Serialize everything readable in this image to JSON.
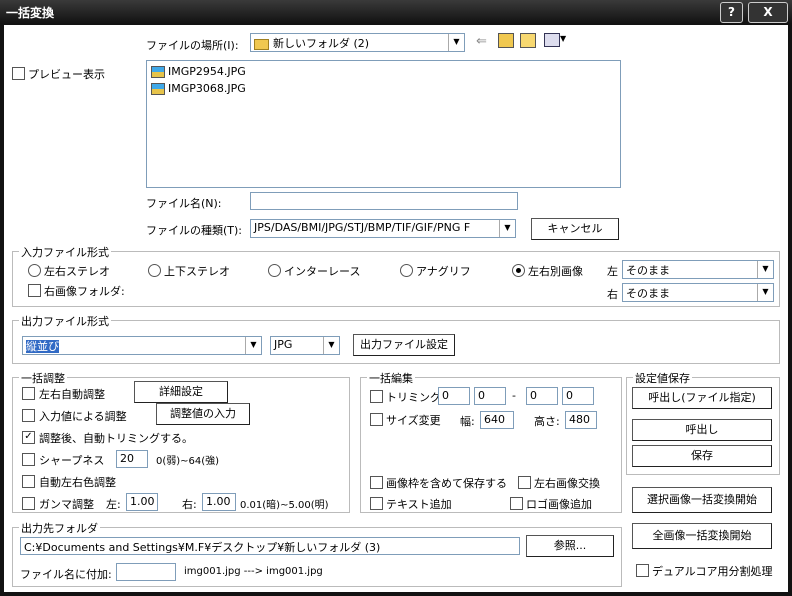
{
  "window": {
    "title": "一括変換",
    "help": "?",
    "close": "X"
  },
  "file_dialog": {
    "location_label": "ファイルの場所(I):",
    "location_value": "新しいフォルダ (2)",
    "preview_label": "プレビュー表示",
    "files": [
      "IMGP2954.JPG",
      "IMGP3068.JPG"
    ],
    "filename_label": "ファイル名(N):",
    "filename_value": "",
    "filetype_label": "ファイルの種類(T):",
    "filetype_value": "JPS/DAS/BMI/JPG/STJ/BMP/TIF/GIF/PNG F",
    "cancel_label": "キャンセル"
  },
  "input_format": {
    "title": "入力ファイル形式",
    "options": [
      "左右ステレオ",
      "上下ステレオ",
      "インターレース",
      "アナグリフ",
      "左右別画像"
    ],
    "selected": "左右別画像",
    "right_folder_label": "右画像フォルダ:",
    "left_label": "左",
    "left_value": "そのまま",
    "right_label": "右",
    "right_value": "そのまま"
  },
  "output_format": {
    "title": "出力ファイル形式",
    "layout_value": "縦並び",
    "format_value": "JPG",
    "settings_button": "出力ファイル設定"
  },
  "batch_adjust": {
    "title": "一括調整",
    "auto_adjust_label": "左右自動調整",
    "detail_button": "詳細設定",
    "input_adjust_label": "入力値による調整",
    "input_value_button": "調整値の入力",
    "auto_trim_label": "調整後、自動トリミングする。",
    "auto_trim_checked": true,
    "sharpness_label": "シャープネス",
    "sharpness_value": "20",
    "sharpness_range": "0(弱)~64(強)",
    "auto_color_label": "自動左右色調整",
    "gamma_label": "ガンマ調整",
    "gamma_left_label": "左:",
    "gamma_left_value": "1.00",
    "gamma_right_label": "右:",
    "gamma_right_value": "1.00",
    "gamma_range": "0.01(暗)~5.00(明)"
  },
  "batch_edit": {
    "title": "一括編集",
    "trim_label": "トリミング",
    "trim_values": [
      "0",
      "0",
      "0",
      "0"
    ],
    "trim_dash": "-",
    "resize_label": "サイズ変更",
    "width_label": "幅:",
    "width_value": "640",
    "height_label": "高さ:",
    "height_value": "480",
    "keep_frame_label": "画像枠を含めて保存する",
    "swap_lr_label": "左右画像交換",
    "add_text_label": "テキスト追加",
    "add_logo_label": "ロゴ画像追加"
  },
  "settings_save": {
    "title": "設定値保存",
    "load_file_button": "呼出し(ファイル指定)",
    "load_button": "呼出し",
    "save_button": "保存"
  },
  "output_folder": {
    "title": "出力先フォルダ",
    "path_value": "C:¥Documents and Settings¥M.F¥デスクトップ¥新しいフォルダ (3)",
    "browse_button": "参照...",
    "suffix_label": "ファイル名に付加:",
    "suffix_value": "",
    "example": "img001.jpg ---> img001.jpg"
  },
  "actions": {
    "convert_selected": "選択画像一括変換開始",
    "convert_all": "全画像一括変換開始",
    "dual_core_label": "デュアルコア用分割処理"
  }
}
